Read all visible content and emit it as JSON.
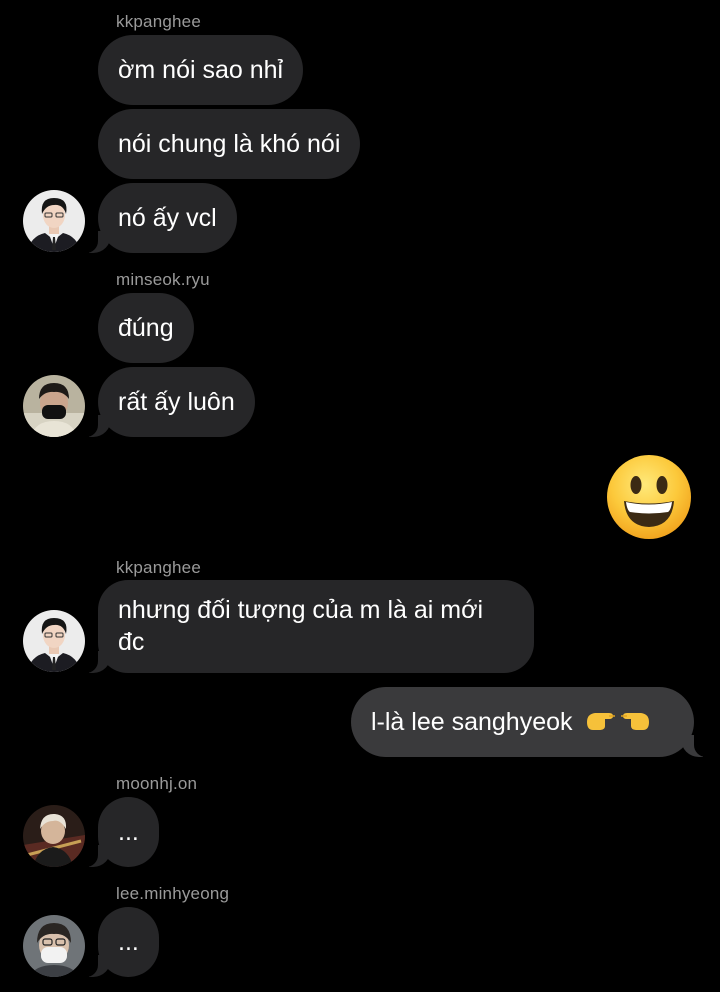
{
  "messages": [
    {
      "sender": "kkpanghee",
      "text": "ờm nói sao nhỉ"
    },
    {
      "text": "nói chung là khó nói"
    },
    {
      "text": "nó ấy vcl",
      "avatar": "kkpanghee-avatar"
    },
    {
      "sender": "minseok.ryu",
      "text": "đúng"
    },
    {
      "text": "rất ấy luôn",
      "avatar": "minseok-avatar"
    },
    {
      "emoji": "smiling-face-emoji",
      "outgoing": true
    },
    {
      "sender": "kkpanghee",
      "text": "nhưng đối tượng của m là ai mới đc",
      "avatar": "kkpanghee-avatar"
    },
    {
      "text": "l-là lee sanghyeok",
      "outgoing": true,
      "trailing_emoji": "pointing-fingers-emoji"
    },
    {
      "sender": "moonhj.on",
      "text": "...",
      "avatar": "moonhj-avatar"
    },
    {
      "sender": "lee.minhyeong",
      "text": "...",
      "avatar": "minhyeong-avatar"
    }
  ],
  "colors": {
    "background": "#000000",
    "incoming_bubble": "#262628",
    "outgoing_bubble": "#3a3a3c",
    "sender_text": "#9a9a9a"
  }
}
